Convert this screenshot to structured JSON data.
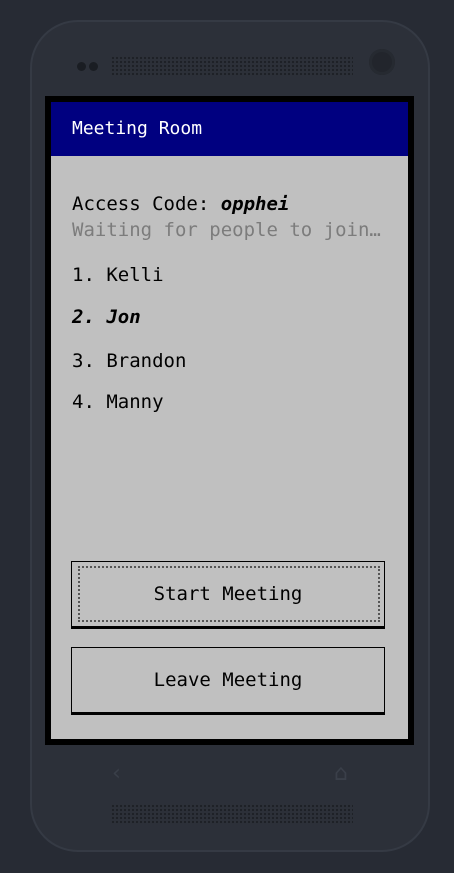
{
  "app": {
    "title": "Meeting Room"
  },
  "access": {
    "label": "Access Code:",
    "code": "opphei"
  },
  "status_text": "Waiting for people to join…",
  "participants": [
    {
      "label": "1. Kelli",
      "is_current_user": false
    },
    {
      "label": "2. Jon",
      "is_current_user": true
    },
    {
      "label": "3. Brandon",
      "is_current_user": false
    },
    {
      "label": "4. Manny",
      "is_current_user": false
    }
  ],
  "buttons": {
    "start_label": "Start Meeting",
    "leave_label": "Leave Meeting"
  },
  "device": {
    "back_icon": "back-icon",
    "home_icon": "home-icon"
  },
  "colors": {
    "titlebar": "#000080",
    "background": "#c0c0c0",
    "muted_text": "#7c7c7c"
  }
}
